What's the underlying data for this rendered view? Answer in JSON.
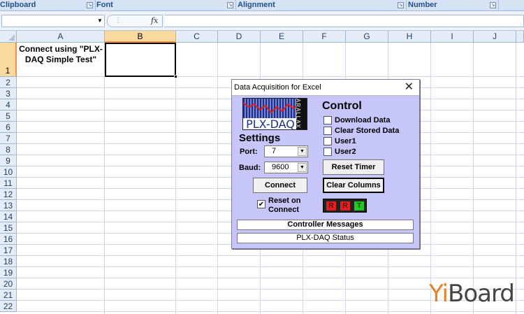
{
  "ribbon": {
    "groups": [
      {
        "label": "Clipboard"
      },
      {
        "label": "Font"
      },
      {
        "label": "Alignment"
      },
      {
        "label": "Number"
      }
    ]
  },
  "formula_bar": {
    "name_box": "",
    "fx_label": "fx",
    "value": ""
  },
  "columns": [
    "A",
    "B",
    "C",
    "D",
    "E",
    "F",
    "G",
    "H",
    "I",
    "J"
  ],
  "selected_column": "B",
  "rows": [
    "1",
    "2",
    "3",
    "4",
    "5",
    "6",
    "7",
    "8",
    "9",
    "10",
    "11",
    "12",
    "13",
    "14",
    "15",
    "16",
    "17",
    "18",
    "19",
    "20",
    "21",
    "22"
  ],
  "selected_row": "1",
  "cells": {
    "A1": "Connect using \"PLX-DAQ Simple Test\""
  },
  "dialog": {
    "title": "Data Acquisition for Excel",
    "close_label": "✕",
    "logo_text": "PLX-DAQ",
    "logo_side_text": "PARALLAX",
    "settings_header": "Settings",
    "port_label": "Port:",
    "port_value": "7",
    "baud_label": "Baud:",
    "baud_value": "9600",
    "connect_label": "Connect",
    "reset_on_connect_label": "Reset on Connect",
    "reset_on_connect_checked": true,
    "control_header": "Control",
    "checkboxes": [
      {
        "label": "Download Data",
        "checked": false
      },
      {
        "label": "Clear Stored Data",
        "checked": false
      },
      {
        "label": "User1",
        "checked": false
      },
      {
        "label": "User2",
        "checked": false
      }
    ],
    "reset_timer_label": "Reset Timer",
    "clear_columns_label": "Clear Columns",
    "leds": [
      {
        "label": "R",
        "color": "#e02020"
      },
      {
        "label": "R",
        "color": "#e02020"
      },
      {
        "label": "T",
        "color": "#22c822"
      }
    ],
    "controller_messages_label": "Controller Messages",
    "status_label": "PLX-DAQ Status"
  },
  "watermark": {
    "text_part1": "Yi",
    "text_part2": "Board",
    "color1": "#e8822a",
    "color2": "#444444"
  }
}
